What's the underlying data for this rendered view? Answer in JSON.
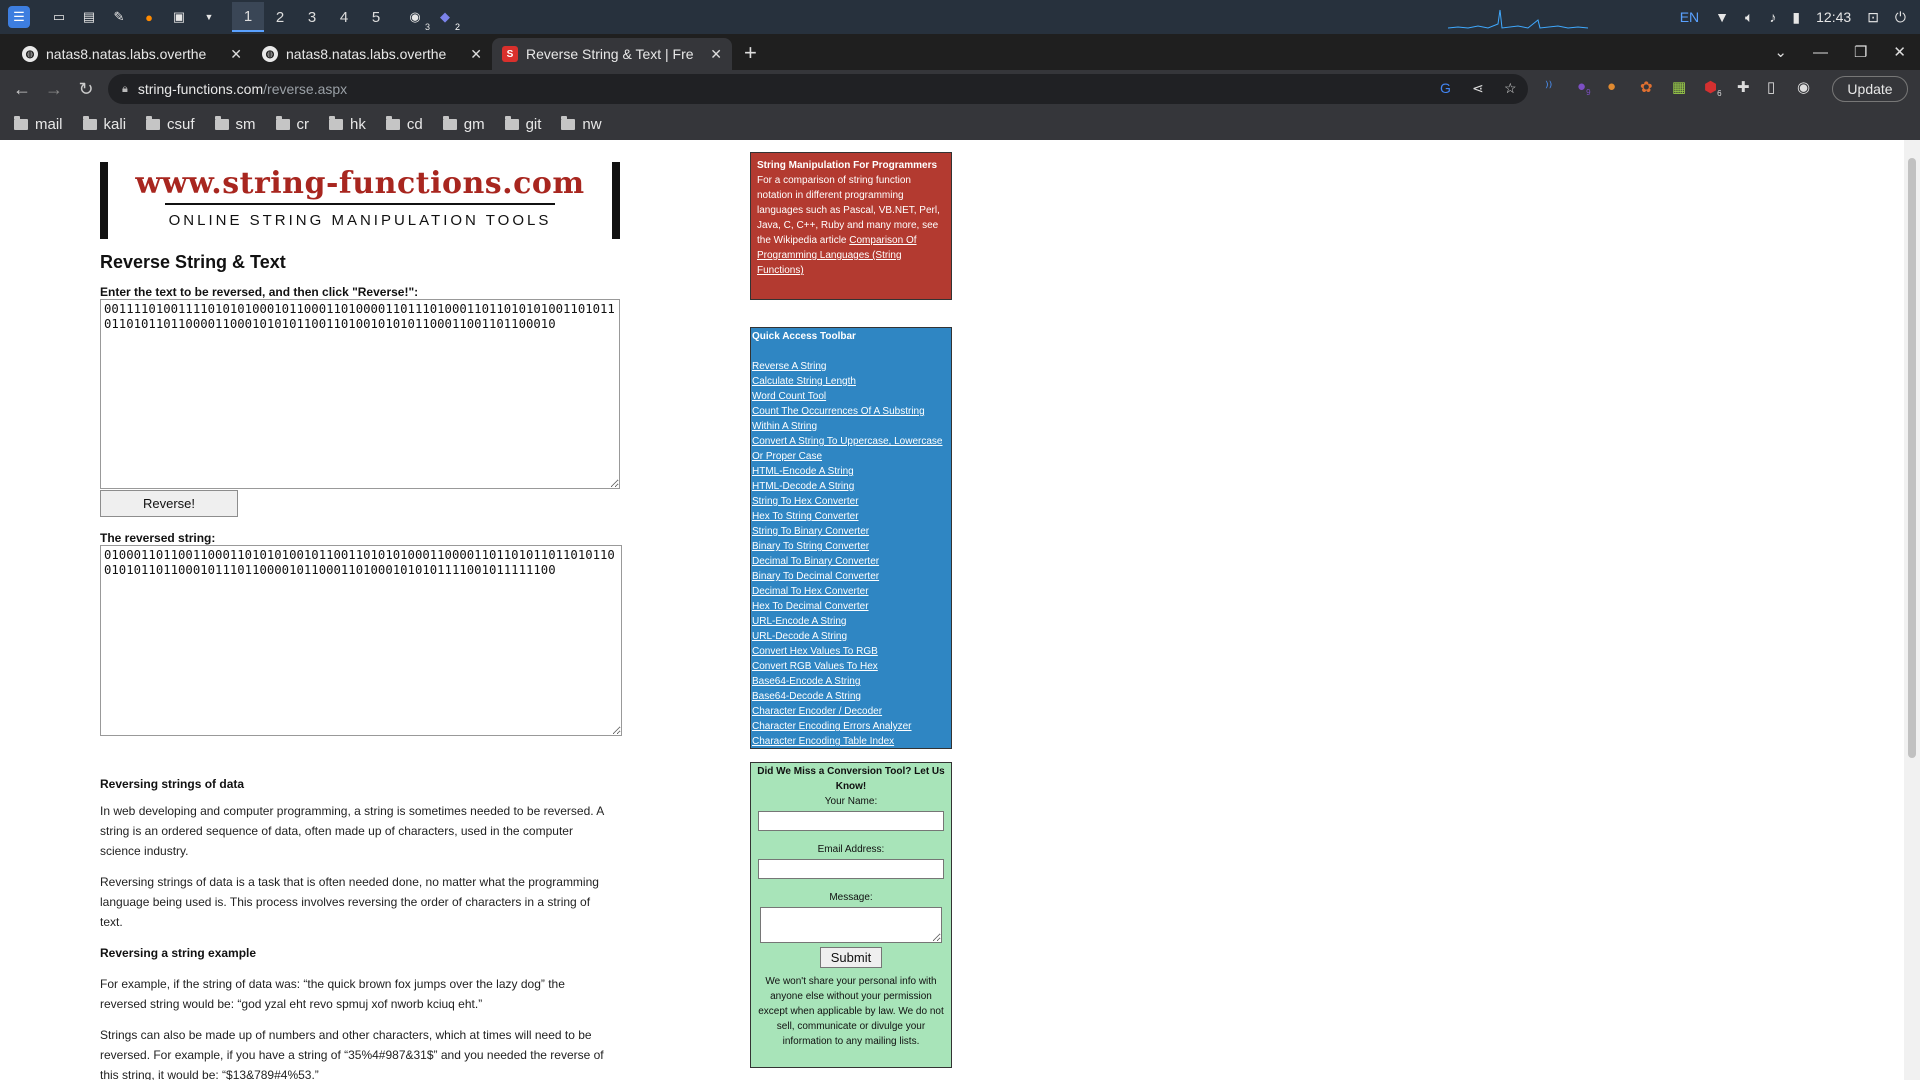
{
  "taskbar": {
    "workspaces": [
      "1",
      "2",
      "3",
      "4",
      "5"
    ],
    "chrome_badge": "3",
    "teams_badge": "2",
    "lang": "EN",
    "time": "12:43"
  },
  "tabs": [
    {
      "title": "natas8.natas.labs.overthe",
      "active": false
    },
    {
      "title": "natas8.natas.labs.overthe",
      "active": false
    },
    {
      "title": "Reverse String & Text | Fre",
      "active": true
    }
  ],
  "address": {
    "host": "string-functions.com",
    "path": "/reverse.aspx"
  },
  "update_label": "Update",
  "ext_badges": {
    "a": "9",
    "b": "6"
  },
  "bookmarks": [
    "mail",
    "kali",
    "csuf",
    "sm",
    "cr",
    "hk",
    "cd",
    "gm",
    "git",
    "nw"
  ],
  "page": {
    "logo_line1": "www.string-functions.com",
    "logo_line2": "ONLINE STRING MANIPULATION TOOLS",
    "title": "Reverse String & Text",
    "input_label": "Enter the text to be reversed, and then click \"Reverse!\":",
    "input_value": "0011110100111101010100010110001101000011011101000110110101010011010110110101101100001100010101011001101001010101100011001101100010",
    "button": "Reverse!",
    "output_label": "The reversed string:",
    "output_value": "0100011011001100011010101001011001101010100011000011011010110110101100101011011000101110110000101100011010001010101111001011111100",
    "article": {
      "h1": "Reversing strings of data",
      "p1": "In web developing and computer programming, a string is sometimes needed to be reversed. A string is an ordered sequence of data, often made up of characters, used in the computer science industry.",
      "p2": "Reversing strings of data is a task that is often needed done, no matter what the programming language being used is. This process involves reversing the order of characters in a string of text.",
      "h2": "Reversing a string example",
      "p3": "For example, if the string of data was: “the quick brown fox jumps over the lazy dog” the reversed string would be: “god yzal eht revo spmuj xof nworb kciuq eht.”",
      "p4": "Strings can also be made up of numbers and other characters, which at times will need to be reversed. For example, if you have a string of “35%4#987&31$” and you needed the reverse of this string, it would be: “$13&789#4%53.”"
    }
  },
  "sidebar": {
    "red": {
      "title": "String Manipulation For Programmers",
      "text": "For a comparison of string function notation in different programming languages such as Pascal, VB.NET, Perl, Java, C, C++, Ruby and many more, see the Wikipedia article ",
      "link": "Comparison Of Programming Languages (String Functions)"
    },
    "blue": {
      "title": "Quick Access Toolbar",
      "links": [
        "Reverse A String",
        "Calculate String Length",
        "Word Count Tool",
        "Count The Occurrences Of A Substring Within A String",
        "Convert A String To Uppercase, Lowercase Or Proper Case",
        "HTML-Encode A String",
        "HTML-Decode A String",
        "String To Hex Converter",
        "Hex To String Converter",
        "String To Binary Converter",
        "Binary To String Converter",
        "Decimal To Binary Converter",
        "Binary To Decimal Converter",
        "Decimal To Hex Converter",
        "Hex To Decimal Converter",
        "URL-Encode A String",
        "URL-Decode A String",
        "Convert Hex Values To RGB",
        "Convert RGB Values To Hex",
        "Base64-Encode A String",
        "Base64-Decode A String",
        "Character Encoder / Decoder",
        "Character Encoding Errors Analyzer",
        "Character Encoding Table Index"
      ]
    },
    "green": {
      "title": "Did We Miss a Conversion Tool? Let Us Know!",
      "name_label": "Your Name:",
      "email_label": "Email Address:",
      "message_label": "Message:",
      "submit": "Submit",
      "note": "We won't share your personal info with anyone else without your permission except when applicable by law. We do not sell, communicate or divulge your information to any mailing lists."
    }
  },
  "colors": {
    "logo_red": "#a8261f",
    "red_box": "#b33a30",
    "blue_box": "#2f86c3",
    "green_box": "#a8e4b9"
  }
}
